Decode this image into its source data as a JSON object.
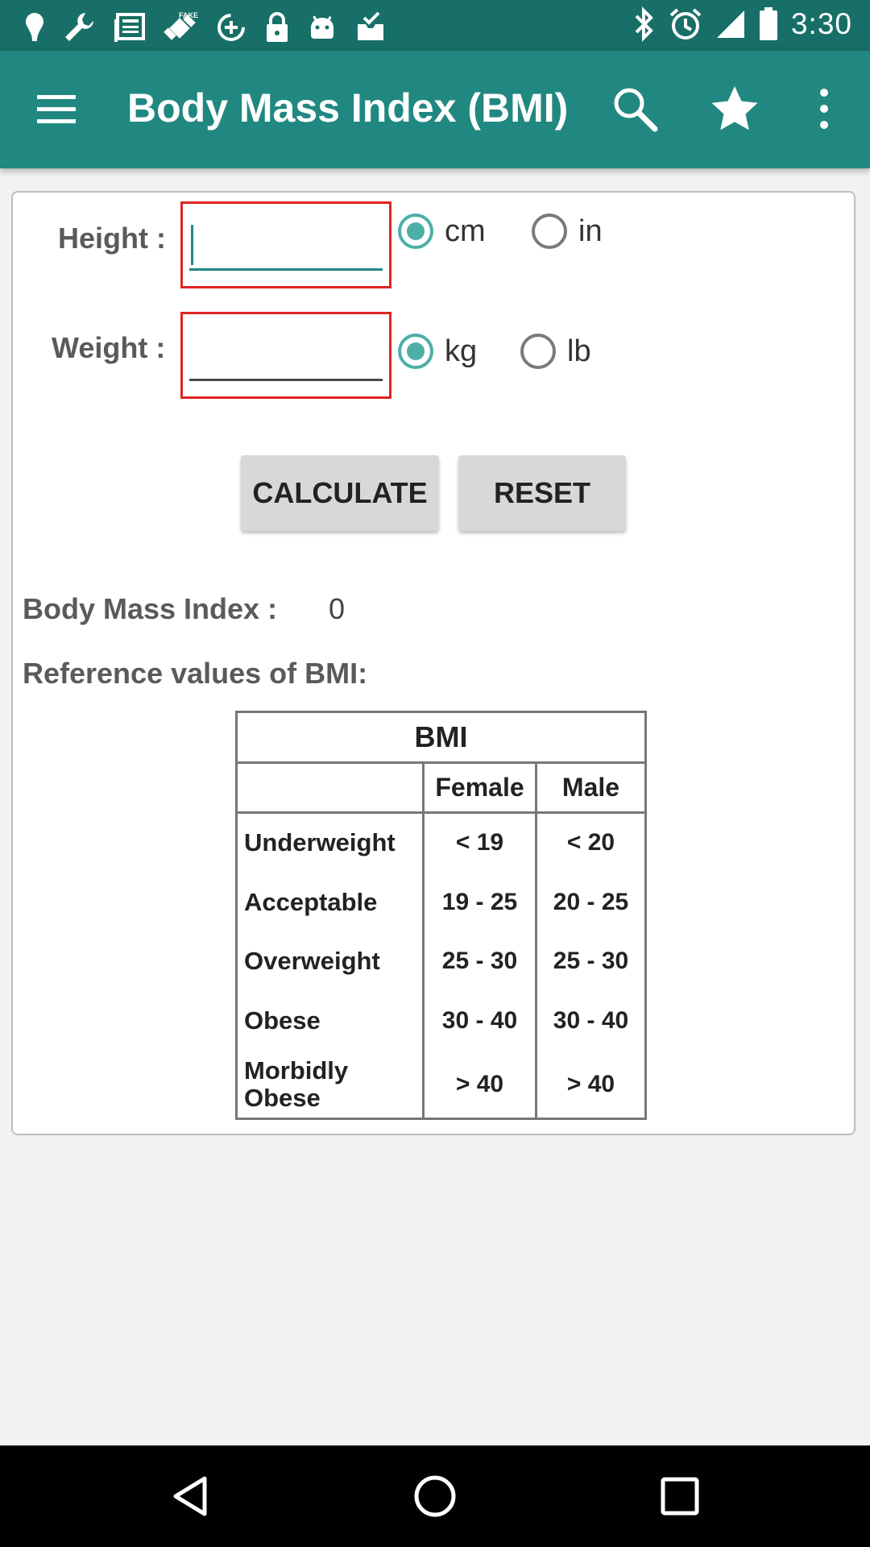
{
  "status_bar": {
    "time": "3:30",
    "left_icons": [
      "notification-icon",
      "wrench-icon",
      "news-icon",
      "fake-gps-icon",
      "data-saver-icon",
      "lock-icon",
      "android-icon",
      "inbox-icon"
    ],
    "right_icons": [
      "bluetooth-icon",
      "alarm-icon",
      "signal-icon",
      "battery-icon"
    ]
  },
  "app_bar": {
    "title": "Body Mass Index (BMI)",
    "menu_icon": "hamburger-menu-icon",
    "search_icon": "search-icon",
    "favorite_icon": "star-icon",
    "overflow_icon": "more-vert-icon"
  },
  "form": {
    "height": {
      "label": "Height :",
      "value": "",
      "units": [
        {
          "label": "cm",
          "checked": true
        },
        {
          "label": "in",
          "checked": false
        }
      ]
    },
    "weight": {
      "label": "Weight :",
      "value": "",
      "units": [
        {
          "label": "kg",
          "checked": true
        },
        {
          "label": "lb",
          "checked": false
        }
      ]
    },
    "calculate_label": "CALCULATE",
    "reset_label": "RESET"
  },
  "result": {
    "label": "Body Mass Index :",
    "value": "0"
  },
  "reference": {
    "heading": "Reference values of BMI:",
    "table": {
      "title": "BMI",
      "columns": [
        "",
        "Female",
        "Male"
      ],
      "rows": [
        {
          "category": "Underweight",
          "female": "< 19",
          "male": "< 20"
        },
        {
          "category": "Acceptable",
          "female": "19 - 25",
          "male": "20 - 25"
        },
        {
          "category": "Overweight",
          "female": "25 - 30",
          "male": "25 - 30"
        },
        {
          "category": "Obese",
          "female": "30 - 40",
          "male": "30 - 40"
        },
        {
          "category": "Morbidly Obese",
          "female": "> 40",
          "male": "> 40"
        }
      ]
    }
  },
  "nav_bar": {
    "back_icon": "back-icon",
    "home_icon": "home-icon",
    "recents_icon": "recents-icon"
  },
  "colors": {
    "status_bar": "#176f67",
    "app_bar": "#208880",
    "accent": "#4dafa5",
    "input_border": "#e02424"
  }
}
